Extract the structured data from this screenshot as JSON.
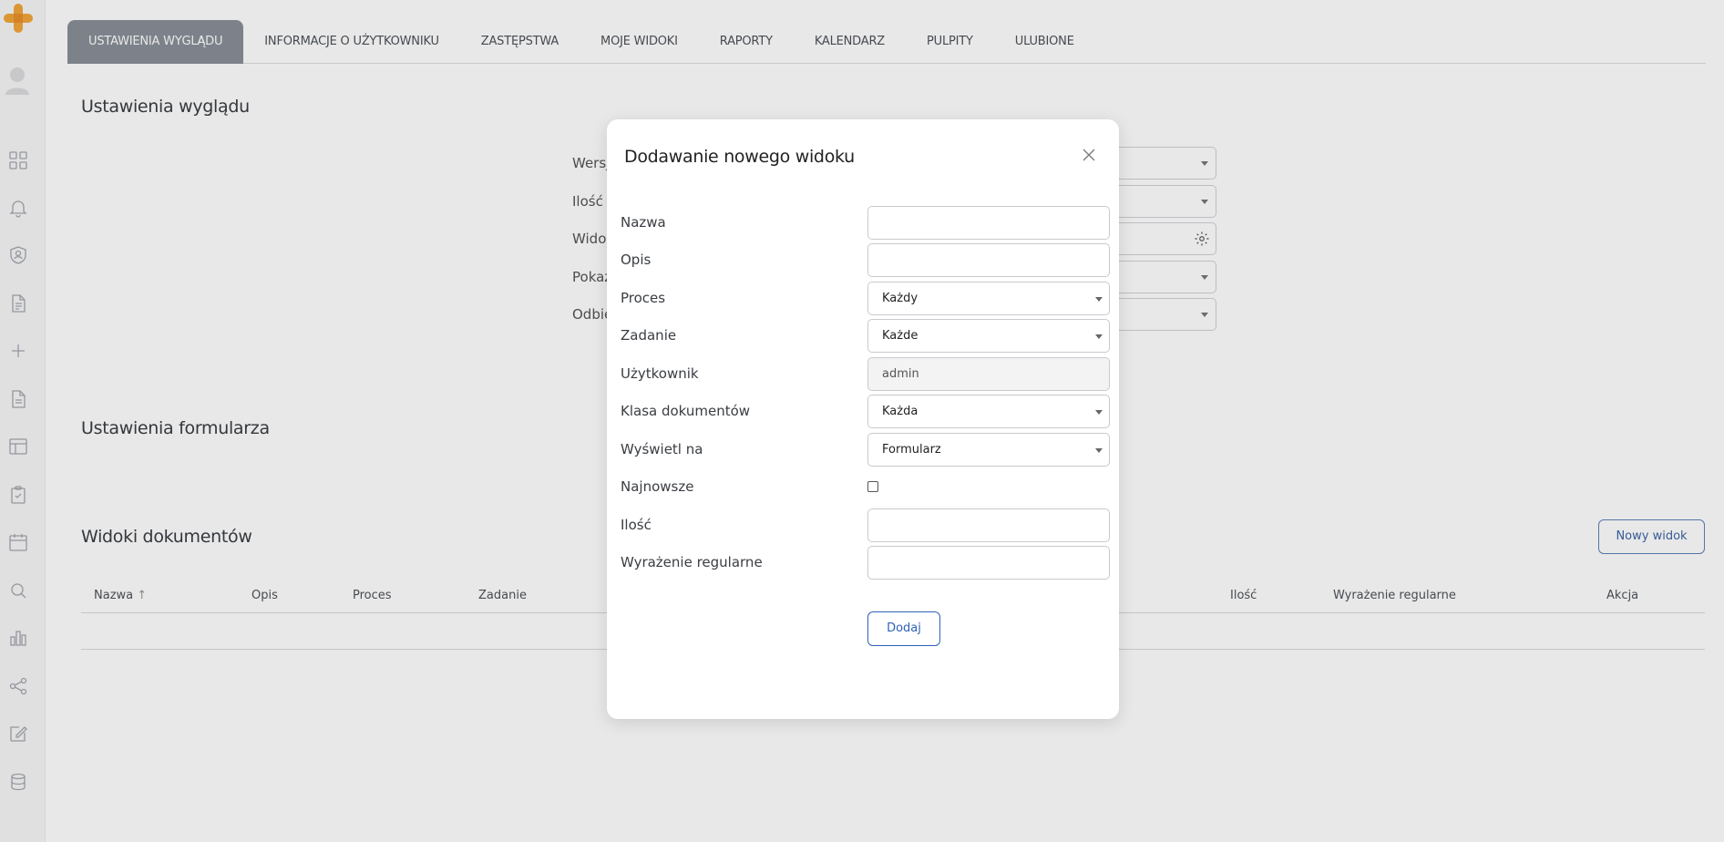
{
  "tabs": [
    {
      "label": "USTAWIENIA WYGLĄDU",
      "active": true
    },
    {
      "label": "INFORMACJE O UŻYTKOWNIKU",
      "active": false
    },
    {
      "label": "ZASTĘPSTWA",
      "active": false
    },
    {
      "label": "MOJE WIDOKI",
      "active": false
    },
    {
      "label": "RAPORTY",
      "active": false
    },
    {
      "label": "KALENDARZ",
      "active": false
    },
    {
      "label": "PULPITY",
      "active": false
    },
    {
      "label": "ULUBIONE",
      "active": false
    }
  ],
  "sidebar": {
    "icons": [
      "dashboard-grid-icon",
      "bell-icon",
      "shield-user-icon",
      "document-list-icon",
      "plus-icon",
      "document-icon",
      "layout-icon",
      "clipboard-check-icon",
      "calendar-icon",
      "search-icon",
      "bar-chart-icon",
      "share-icon",
      "edit-icon",
      "database-icon"
    ]
  },
  "appearance": {
    "title": "Ustawienia wyglądu",
    "labels": [
      "Wersja",
      "Ilość p",
      "Widok",
      "Pokaz",
      "Odbie"
    ]
  },
  "form_settings": {
    "title": "Ustawienia formularza"
  },
  "document_views": {
    "title": "Widoki dokumentów",
    "new_button": "Nowy widok",
    "columns": {
      "name": "Nazwa",
      "sort_glyph": "↑",
      "description": "Opis",
      "process": "Proces",
      "task": "Zadanie",
      "count": "Ilość",
      "regex": "Wyrażenie regularne",
      "action": "Akcja"
    }
  },
  "modal": {
    "title": "Dodawanie nowego widoku",
    "close_glyph": "×",
    "fields": {
      "name": {
        "label": "Nazwa",
        "value": ""
      },
      "description": {
        "label": "Opis",
        "value": ""
      },
      "process": {
        "label": "Proces",
        "value": "Każdy"
      },
      "task": {
        "label": "Zadanie",
        "value": "Każde"
      },
      "user": {
        "label": "Użytkownik",
        "value": "admin"
      },
      "doc_class": {
        "label": "Klasa dokumentów",
        "value": "Każda"
      },
      "display_on": {
        "label": "Wyświetl na",
        "value": "Formularz"
      },
      "newest": {
        "label": "Najnowsze",
        "checked": false
      },
      "count": {
        "label": "Ilość",
        "value": ""
      },
      "regex": {
        "label": "Wyrażenie regularne",
        "value": ""
      }
    },
    "add_button": "Dodaj"
  },
  "colors": {
    "active_tab": "#8a8f98",
    "primary": "#2f63b5",
    "logo_orange": "#f2a73b"
  }
}
